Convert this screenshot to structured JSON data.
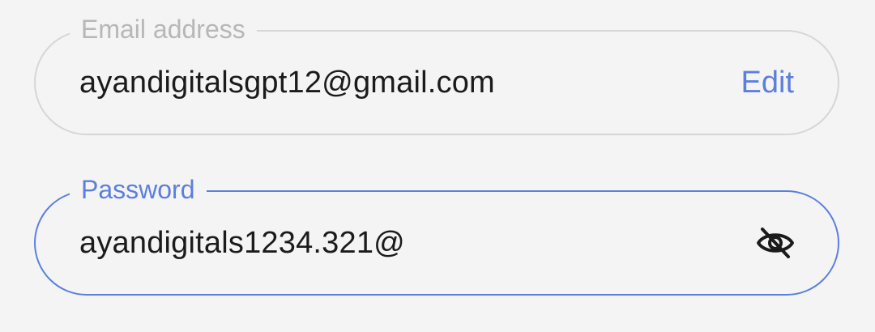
{
  "email_field": {
    "label": "Email address",
    "value": "ayandigitalsgpt12@gmail.com",
    "edit_label": "Edit"
  },
  "password_field": {
    "label": "Password",
    "value": "ayandigitals1234.321@",
    "visibility_icon": "eye-slash-icon"
  },
  "colors": {
    "accent": "#5b7fdd",
    "muted_label": "#b7b7b7",
    "inactive_border": "#d6d6d6",
    "text": "#1b1b1b",
    "background": "#f4f4f4"
  }
}
